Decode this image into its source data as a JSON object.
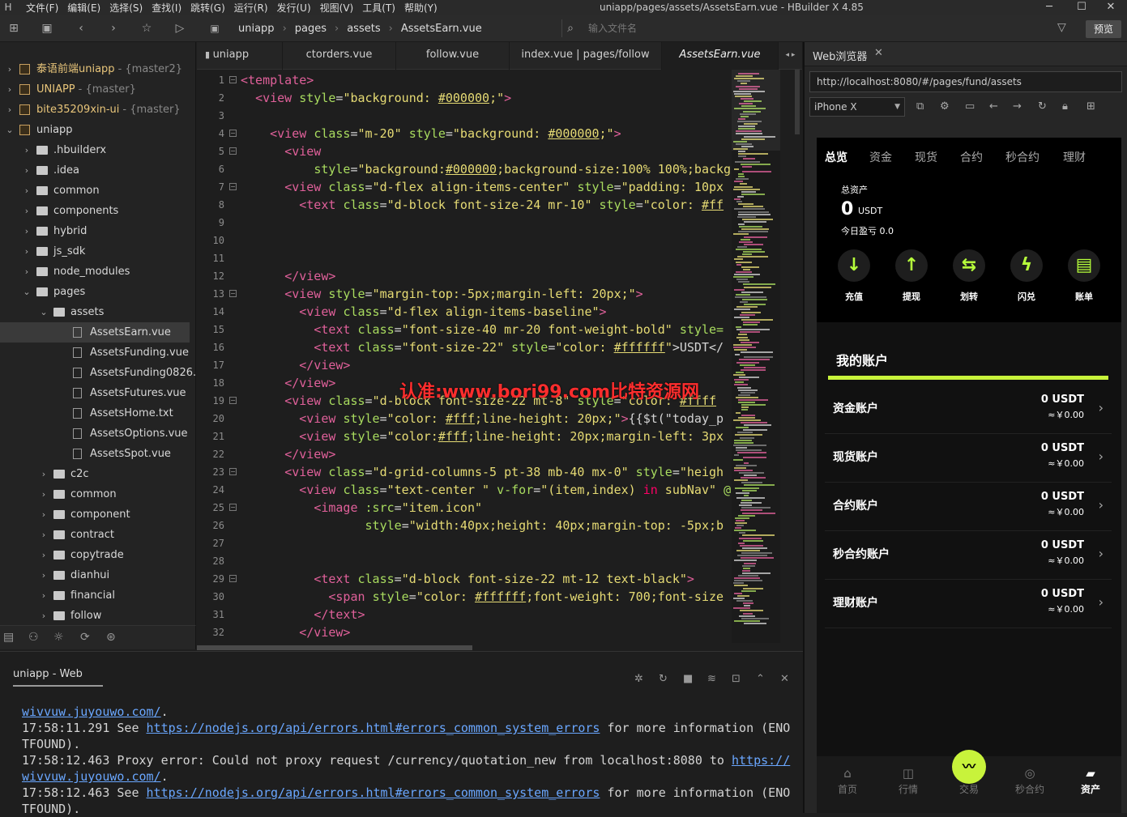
{
  "window": {
    "title": "uniapp/pages/assets/AssetsEarn.vue - HBuilder X 4.85",
    "menu": [
      "文件(F)",
      "编辑(E)",
      "选择(S)",
      "查找(I)",
      "跳转(G)",
      "运行(R)",
      "发行(U)",
      "视图(V)",
      "工具(T)",
      "帮助(Y)"
    ]
  },
  "toolbar": {
    "breadcrumbs": [
      "uniapp",
      "pages",
      "assets",
      "AssetsEarn.vue"
    ],
    "file_input_placeholder": "输入文件名",
    "preview_label": "预览"
  },
  "sidebar": {
    "items": [
      {
        "label": "泰语前端uniapp",
        "branch": "- {master2}",
        "depth": 0,
        "type": "project",
        "expanded": false
      },
      {
        "label": "UNIAPP",
        "branch": "- {master}",
        "depth": 0,
        "type": "project",
        "expanded": false
      },
      {
        "label": "bite35209xin-ui",
        "branch": "- {master}",
        "depth": 0,
        "type": "project",
        "expanded": false
      },
      {
        "label": "uniapp",
        "branch": "",
        "depth": 0,
        "type": "project",
        "expanded": true
      },
      {
        "label": ".hbuilderx",
        "depth": 1,
        "type": "folder",
        "expanded": false
      },
      {
        "label": ".idea",
        "depth": 1,
        "type": "folder",
        "expanded": false
      },
      {
        "label": "common",
        "depth": 1,
        "type": "folder",
        "expanded": false
      },
      {
        "label": "components",
        "depth": 1,
        "type": "folder",
        "expanded": false
      },
      {
        "label": "hybrid",
        "depth": 1,
        "type": "folder",
        "expanded": false
      },
      {
        "label": "js_sdk",
        "depth": 1,
        "type": "folder",
        "expanded": false
      },
      {
        "label": "node_modules",
        "depth": 1,
        "type": "folder",
        "expanded": false
      },
      {
        "label": "pages",
        "depth": 1,
        "type": "folder",
        "expanded": true
      },
      {
        "label": "assets",
        "depth": 2,
        "type": "folder",
        "expanded": true
      },
      {
        "label": "AssetsEarn.vue",
        "depth": 3,
        "type": "file",
        "selected": true
      },
      {
        "label": "AssetsFunding.vue",
        "depth": 3,
        "type": "file"
      },
      {
        "label": "AssetsFunding0826...",
        "depth": 3,
        "type": "file"
      },
      {
        "label": "AssetsFutures.vue",
        "depth": 3,
        "type": "file"
      },
      {
        "label": "AssetsHome.txt",
        "depth": 3,
        "type": "file"
      },
      {
        "label": "AssetsOptions.vue",
        "depth": 3,
        "type": "file"
      },
      {
        "label": "AssetsSpot.vue",
        "depth": 3,
        "type": "file"
      },
      {
        "label": "c2c",
        "depth": 2,
        "type": "folder",
        "expanded": false
      },
      {
        "label": "common",
        "depth": 2,
        "type": "folder",
        "expanded": false
      },
      {
        "label": "component",
        "depth": 2,
        "type": "folder",
        "expanded": false
      },
      {
        "label": "contract",
        "depth": 2,
        "type": "folder",
        "expanded": false
      },
      {
        "label": "copytrade",
        "depth": 2,
        "type": "folder",
        "expanded": false
      },
      {
        "label": "dianhui",
        "depth": 2,
        "type": "folder",
        "expanded": false
      },
      {
        "label": "financial",
        "depth": 2,
        "type": "folder",
        "expanded": false
      },
      {
        "label": "follow",
        "depth": 2,
        "type": "folder",
        "expanded": false
      }
    ]
  },
  "editor": {
    "tabs": [
      "uniapp",
      "ctorders.vue",
      "follow.vue",
      "index.vue | pages/follow",
      "AssetsEarn.vue"
    ],
    "active_tab": "AssetsEarn.vue",
    "lines": [
      [
        [
          "tg",
          "<template>"
        ]
      ],
      [
        [
          "pl",
          "  "
        ],
        [
          "tg",
          "<view "
        ],
        [
          "at",
          "style"
        ],
        [
          "pl",
          "="
        ],
        [
          "st",
          "\"background: "
        ],
        [
          "col",
          "#000000"
        ],
        [
          "st",
          ";\""
        ],
        [
          "tg",
          ">"
        ]
      ],
      [],
      [
        [
          "pl",
          "    "
        ],
        [
          "tg",
          "<view "
        ],
        [
          "at",
          "class"
        ],
        [
          "pl",
          "="
        ],
        [
          "st",
          "\"m-20\" "
        ],
        [
          "at",
          "style"
        ],
        [
          "pl",
          "="
        ],
        [
          "st",
          "\"background: "
        ],
        [
          "col",
          "#000000"
        ],
        [
          "st",
          ";\""
        ],
        [
          "tg",
          ">"
        ]
      ],
      [
        [
          "pl",
          "      "
        ],
        [
          "tg",
          "<view"
        ]
      ],
      [
        [
          "pl",
          "          "
        ],
        [
          "at",
          "style"
        ],
        [
          "pl",
          "="
        ],
        [
          "st",
          "\"background:"
        ],
        [
          "col",
          "#000000"
        ],
        [
          "st",
          ";background-size:100% 100%;backgr"
        ]
      ],
      [
        [
          "pl",
          "      "
        ],
        [
          "tg",
          "<view "
        ],
        [
          "at",
          "class"
        ],
        [
          "pl",
          "="
        ],
        [
          "st",
          "\"d-flex align-items-center\" "
        ],
        [
          "at",
          "style"
        ],
        [
          "pl",
          "="
        ],
        [
          "st",
          "\"padding: 10px"
        ]
      ],
      [
        [
          "pl",
          "        "
        ],
        [
          "tg",
          "<text "
        ],
        [
          "at",
          "class"
        ],
        [
          "pl",
          "="
        ],
        [
          "st",
          "\"d-block font-size-24 mr-10\" "
        ],
        [
          "at",
          "style"
        ],
        [
          "pl",
          "="
        ],
        [
          "st",
          "\"color: "
        ],
        [
          "col",
          "#ff"
        ]
      ],
      [],
      [],
      [],
      [
        [
          "pl",
          "      "
        ],
        [
          "tg",
          "</view>"
        ]
      ],
      [
        [
          "pl",
          "      "
        ],
        [
          "tg",
          "<view "
        ],
        [
          "at",
          "style"
        ],
        [
          "pl",
          "="
        ],
        [
          "st",
          "\"margin-top:-5px;margin-left: 20px;\""
        ],
        [
          "tg",
          ">"
        ]
      ],
      [
        [
          "pl",
          "        "
        ],
        [
          "tg",
          "<view "
        ],
        [
          "at",
          "class"
        ],
        [
          "pl",
          "="
        ],
        [
          "st",
          "\"d-flex align-items-baseline\""
        ],
        [
          "tg",
          ">"
        ]
      ],
      [
        [
          "pl",
          "          "
        ],
        [
          "tg",
          "<text "
        ],
        [
          "at",
          "class"
        ],
        [
          "pl",
          "="
        ],
        [
          "st",
          "\"font-size-40 mr-20 font-weight-bold\" "
        ],
        [
          "at",
          "style="
        ]
      ],
      [
        [
          "pl",
          "          "
        ],
        [
          "tg",
          "<text "
        ],
        [
          "at",
          "class"
        ],
        [
          "pl",
          "="
        ],
        [
          "st",
          "\"font-size-22\" "
        ],
        [
          "at",
          "style"
        ],
        [
          "pl",
          "="
        ],
        [
          "st",
          "\"color: "
        ],
        [
          "col",
          "#ffffff"
        ],
        [
          "st",
          "\""
        ],
        [
          "pl",
          ">USDT</"
        ]
      ],
      [
        [
          "pl",
          "        "
        ],
        [
          "tg",
          "</view>"
        ]
      ],
      [
        [
          "pl",
          "      "
        ],
        [
          "tg",
          "</view>"
        ]
      ],
      [
        [
          "pl",
          "      "
        ],
        [
          "tg",
          "<view "
        ],
        [
          "at",
          "class"
        ],
        [
          "pl",
          "="
        ],
        [
          "st",
          "\"d-block font-size-22 mt-8\" "
        ],
        [
          "at",
          "style"
        ],
        [
          "pl",
          "="
        ],
        [
          "st",
          "\"color: "
        ],
        [
          "col",
          "#ffff"
        ]
      ],
      [
        [
          "pl",
          "        "
        ],
        [
          "tg",
          "<view "
        ],
        [
          "at",
          "style"
        ],
        [
          "pl",
          "="
        ],
        [
          "st",
          "\"color: "
        ],
        [
          "col",
          "#fff"
        ],
        [
          "st",
          ";line-height: 20px;\""
        ],
        [
          "tg",
          ">"
        ],
        [
          "pl",
          "{{$t(\"today_p"
        ]
      ],
      [
        [
          "pl",
          "        "
        ],
        [
          "tg",
          "<view "
        ],
        [
          "at",
          "style"
        ],
        [
          "pl",
          "="
        ],
        [
          "st",
          "\"color:"
        ],
        [
          "col",
          "#fff"
        ],
        [
          "st",
          ";line-height: 20px;margin-left: 3px"
        ]
      ],
      [
        [
          "pl",
          "      "
        ],
        [
          "tg",
          "</view>"
        ]
      ],
      [
        [
          "pl",
          "      "
        ],
        [
          "tg",
          "<view "
        ],
        [
          "at",
          "class"
        ],
        [
          "pl",
          "="
        ],
        [
          "st",
          "\"d-grid-columns-5 pt-38 mb-40 mx-0\" "
        ],
        [
          "at",
          "style"
        ],
        [
          "pl",
          "="
        ],
        [
          "st",
          "\"heigh"
        ]
      ],
      [
        [
          "pl",
          "        "
        ],
        [
          "tg",
          "<view "
        ],
        [
          "at",
          "class"
        ],
        [
          "pl",
          "="
        ],
        [
          "st",
          "\"text-center \" "
        ],
        [
          "at",
          "v-for"
        ],
        [
          "pl",
          "="
        ],
        [
          "st",
          "\"(item,index) "
        ],
        [
          "kw",
          "in"
        ],
        [
          "st",
          " subNav\" "
        ],
        [
          "at",
          "@"
        ]
      ],
      [
        [
          "pl",
          "          "
        ],
        [
          "tg",
          "<image "
        ],
        [
          "at",
          ":src"
        ],
        [
          "pl",
          "="
        ],
        [
          "st",
          "\"item.icon\""
        ]
      ],
      [
        [
          "pl",
          "                 "
        ],
        [
          "at",
          "style"
        ],
        [
          "pl",
          "="
        ],
        [
          "st",
          "\"width:40px;height: 40px;margin-top: -5px;b"
        ]
      ],
      [],
      [],
      [
        [
          "pl",
          "          "
        ],
        [
          "tg",
          "<text "
        ],
        [
          "at",
          "class"
        ],
        [
          "pl",
          "="
        ],
        [
          "st",
          "\"d-block font-size-22 mt-12 text-black\""
        ],
        [
          "tg",
          ">"
        ]
      ],
      [
        [
          "pl",
          "            "
        ],
        [
          "tg",
          "<span "
        ],
        [
          "at",
          "style"
        ],
        [
          "pl",
          "="
        ],
        [
          "st",
          "\"color: "
        ],
        [
          "col",
          "#ffffff"
        ],
        [
          "st",
          ";font-weight: 700;font-size"
        ]
      ],
      [
        [
          "pl",
          "          "
        ],
        [
          "tg",
          "</text>"
        ]
      ],
      [
        [
          "pl",
          "        "
        ],
        [
          "tg",
          "</view>"
        ]
      ]
    ],
    "folds": [
      1,
      4,
      5,
      7,
      13,
      19,
      23,
      25,
      29
    ],
    "watermark": "认准:www.bori99.com比特资源网"
  },
  "console": {
    "tab_label": "uniapp - Web",
    "lines": [
      [
        [
          "lk",
          "wivvuw.juyouwo.com/"
        ],
        [
          "pl",
          "."
        ]
      ],
      [
        [
          "pl",
          "17:58:11.291 See "
        ],
        [
          "lk",
          "https://nodejs.org/api/errors.html#errors_common_system_errors"
        ],
        [
          "pl",
          " for more information (ENO"
        ]
      ],
      [
        [
          "pl",
          "TFOUND)."
        ]
      ],
      [
        [
          "pl",
          "17:58:12.463 Proxy error: Could not proxy request /currency/quotation_new from localhost:8080 to "
        ],
        [
          "lk",
          "https://"
        ]
      ],
      [
        [
          "lk",
          "wivvuw.juyouwo.com/"
        ],
        [
          "pl",
          "."
        ]
      ],
      [
        [
          "pl",
          "17:58:12.463 See "
        ],
        [
          "lk",
          "https://nodejs.org/api/errors.html#errors_common_system_errors"
        ],
        [
          "pl",
          " for more information (ENO"
        ]
      ],
      [
        [
          "pl",
          "TFOUND)."
        ]
      ]
    ]
  },
  "browser": {
    "tab_label": "Web浏览器",
    "url": "http://localhost:8080/#/pages/fund/assets",
    "device": "iPhone X",
    "app": {
      "tabs": [
        "总览",
        "资金",
        "现货",
        "合约",
        "秒合约",
        "理财"
      ],
      "total_label": "总资产",
      "total_value": "0",
      "total_unit": "USDT",
      "today_pnl": "今日盈亏 0.0",
      "actions": [
        {
          "label": "充值",
          "icon": "arrow-down-icon",
          "glyph": "↓"
        },
        {
          "label": "提现",
          "icon": "arrow-up-icon",
          "glyph": "↑"
        },
        {
          "label": "划转",
          "icon": "transfer-icon",
          "glyph": "⇆"
        },
        {
          "label": "闪兑",
          "icon": "flash-icon",
          "glyph": "ϟ"
        },
        {
          "label": "账单",
          "icon": "bill-icon",
          "glyph": "▤"
        }
      ],
      "my_accounts_title": "我的账户",
      "accounts": [
        {
          "name": "资金账户",
          "value": "0 USDT",
          "sub": "≈￥0.00"
        },
        {
          "name": "现货账户",
          "value": "0 USDT",
          "sub": "≈￥0.00"
        },
        {
          "name": "合约账户",
          "value": "0 USDT",
          "sub": "≈￥0.00"
        },
        {
          "name": "秒合约账户",
          "value": "0 USDT",
          "sub": "≈￥0.00"
        },
        {
          "name": "理财账户",
          "value": "0 USDT",
          "sub": "≈￥0.00"
        }
      ],
      "nav": [
        "首页",
        "行情",
        "交易",
        "秒合约",
        "资产"
      ],
      "accent": "#c8f33b"
    }
  }
}
